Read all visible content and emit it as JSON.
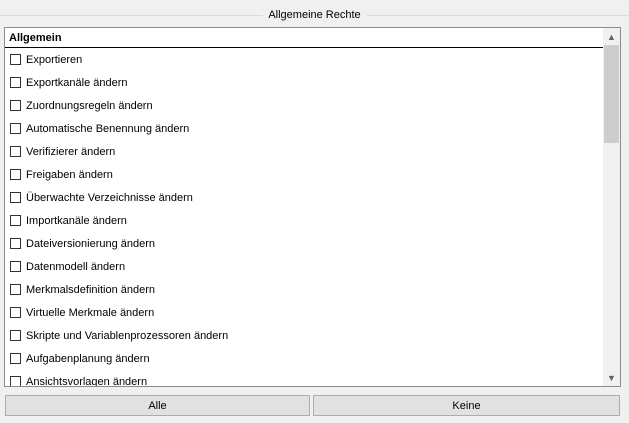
{
  "group": {
    "title": "Allgemeine Rechte"
  },
  "list": {
    "section_header": "Allgemein",
    "items": [
      {
        "label": "Exportieren",
        "checked": false
      },
      {
        "label": "Exportkanäle ändern",
        "checked": false
      },
      {
        "label": "Zuordnungsregeln ändern",
        "checked": false
      },
      {
        "label": "Automatische Benennung ändern",
        "checked": false
      },
      {
        "label": "Verifizierer ändern",
        "checked": false
      },
      {
        "label": "Freigaben ändern",
        "checked": false
      },
      {
        "label": "Überwachte Verzeichnisse ändern",
        "checked": false
      },
      {
        "label": "Importkanäle ändern",
        "checked": false
      },
      {
        "label": "Dateiversionierung ändern",
        "checked": false
      },
      {
        "label": "Datenmodell ändern",
        "checked": false
      },
      {
        "label": "Merkmalsdefinition ändern",
        "checked": false
      },
      {
        "label": "Virtuelle Merkmale ändern",
        "checked": false
      },
      {
        "label": "Skripte und Variablenprozessoren ändern",
        "checked": false
      },
      {
        "label": "Aufgabenplanung ändern",
        "checked": false
      },
      {
        "label": "Ansichtsvorlagen ändern",
        "checked": false
      }
    ]
  },
  "scrollbar": {
    "up_icon": "▲",
    "down_icon": "▼"
  },
  "buttons": {
    "all_label": "Alle",
    "none_label": "Keine"
  }
}
